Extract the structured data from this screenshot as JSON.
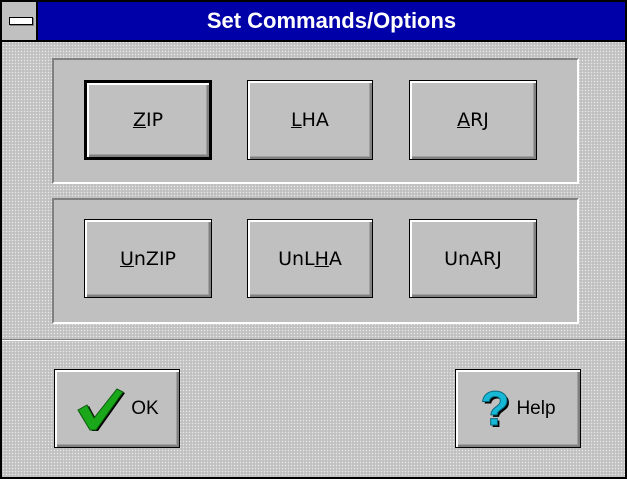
{
  "window": {
    "title": "Set Commands/Options"
  },
  "compress": [
    {
      "pre": "",
      "mnemonic": "Z",
      "post": "IP"
    },
    {
      "pre": "",
      "mnemonic": "L",
      "post": "HA"
    },
    {
      "pre": "",
      "mnemonic": "A",
      "post": "RJ"
    }
  ],
  "extract": [
    {
      "pre": "",
      "mnemonic": "U",
      "post": "nZIP"
    },
    {
      "pre": "UnL",
      "mnemonic": "H",
      "post": "A"
    },
    {
      "pre": "UnAR",
      "mnemonic": "J",
      "post": ""
    }
  ],
  "footer": {
    "ok_label": "OK",
    "help_label": "Help"
  },
  "colors": {
    "titlebar": "#0000a8",
    "face": "#c0c0c0",
    "check": "#1aa81a",
    "help": "#17b8d6"
  }
}
